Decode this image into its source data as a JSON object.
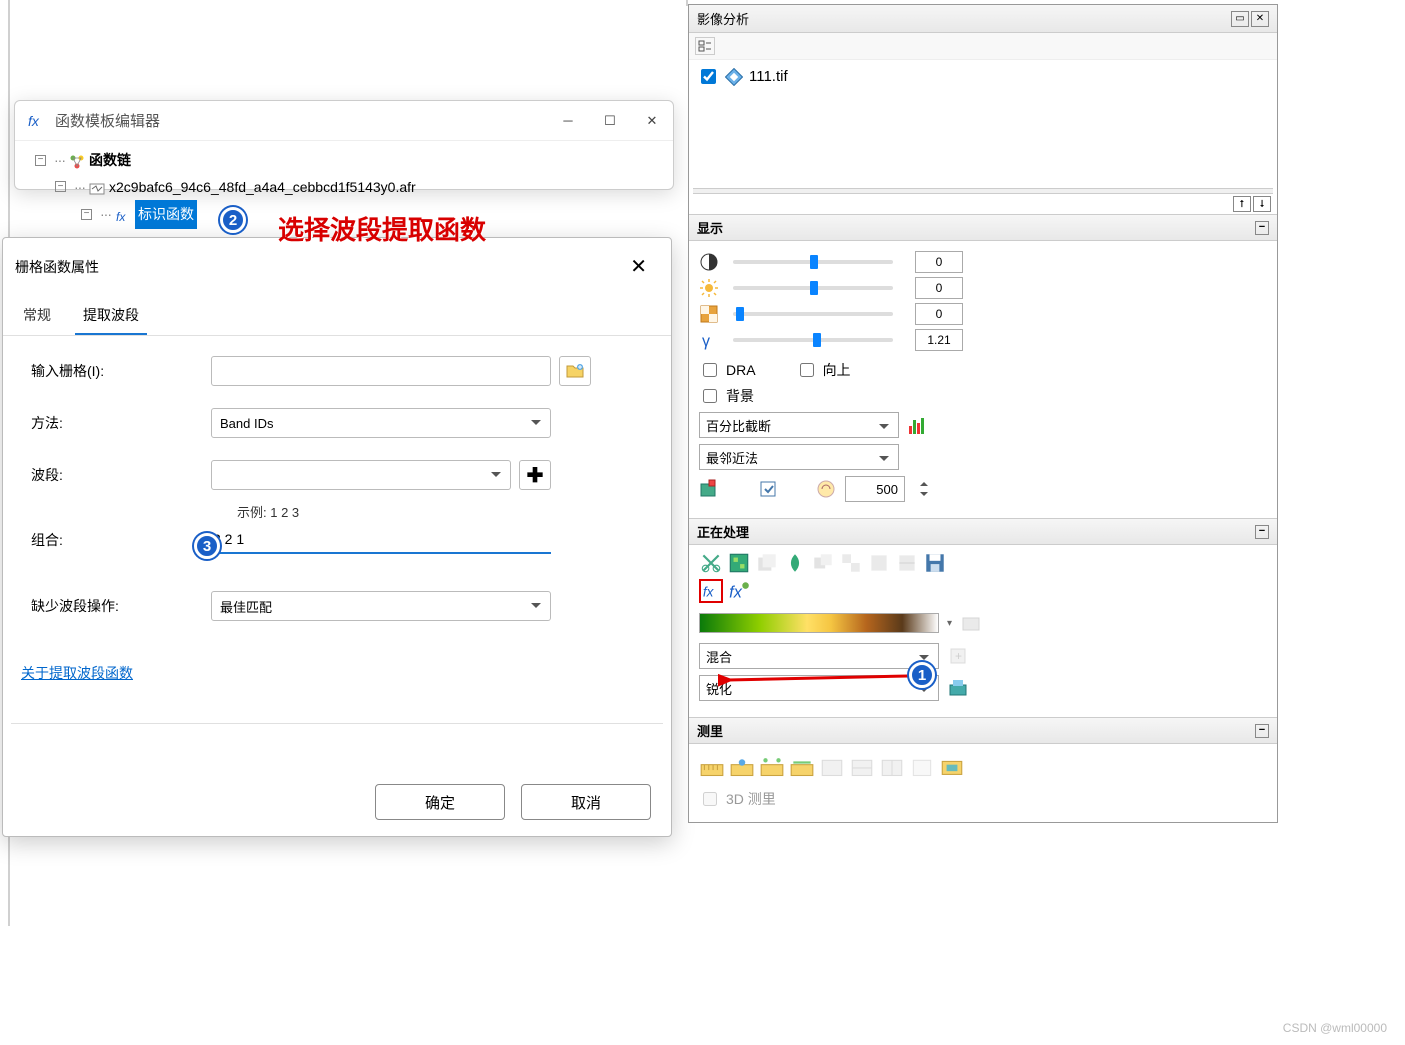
{
  "fx_window": {
    "title": "函数模板编辑器",
    "tree": {
      "root": "函数链",
      "file": "x2c9bafc6_94c6_48fd_a4a4_cebbcd1f5143y0.afr",
      "fn": "标识函数"
    }
  },
  "annotation": {
    "red_text": "选择波段提取函数",
    "callout1": "1",
    "callout2": "2",
    "callout3": "3"
  },
  "props": {
    "title": "栅格函数属性",
    "tabs": {
      "general": "常规",
      "extract": "提取波段"
    },
    "labels": {
      "input_raster": "输入栅格(I):",
      "method": "方法:",
      "bands": "波段:",
      "example": "示例: 1 2 3",
      "combo": "组合:",
      "missing": "缺少波段操作:"
    },
    "values": {
      "method": "Band IDs",
      "combo": "3 2 1",
      "missing": "最佳匹配"
    },
    "link": "关于提取波段函数",
    "btn_ok": "确定",
    "btn_cancel": "取消"
  },
  "right": {
    "panel_title": "影像分析",
    "layer": "111.tif",
    "sections": {
      "display": "显示",
      "processing": "正在处理",
      "measure": "测里"
    },
    "sliders": {
      "contrast": "0",
      "brightness": "0",
      "transparency": "0",
      "gamma": "1.21"
    },
    "checkboxes": {
      "dra": "DRA",
      "up": "向上",
      "bg": "背景",
      "3d": "3D 测里"
    },
    "display": {
      "stretch": "百分比截断",
      "resample": "最邻近法",
      "zoom": "500"
    },
    "processing": {
      "blend": "混合",
      "sharpen": "锐化"
    }
  },
  "watermark": "CSDN @wml00000"
}
